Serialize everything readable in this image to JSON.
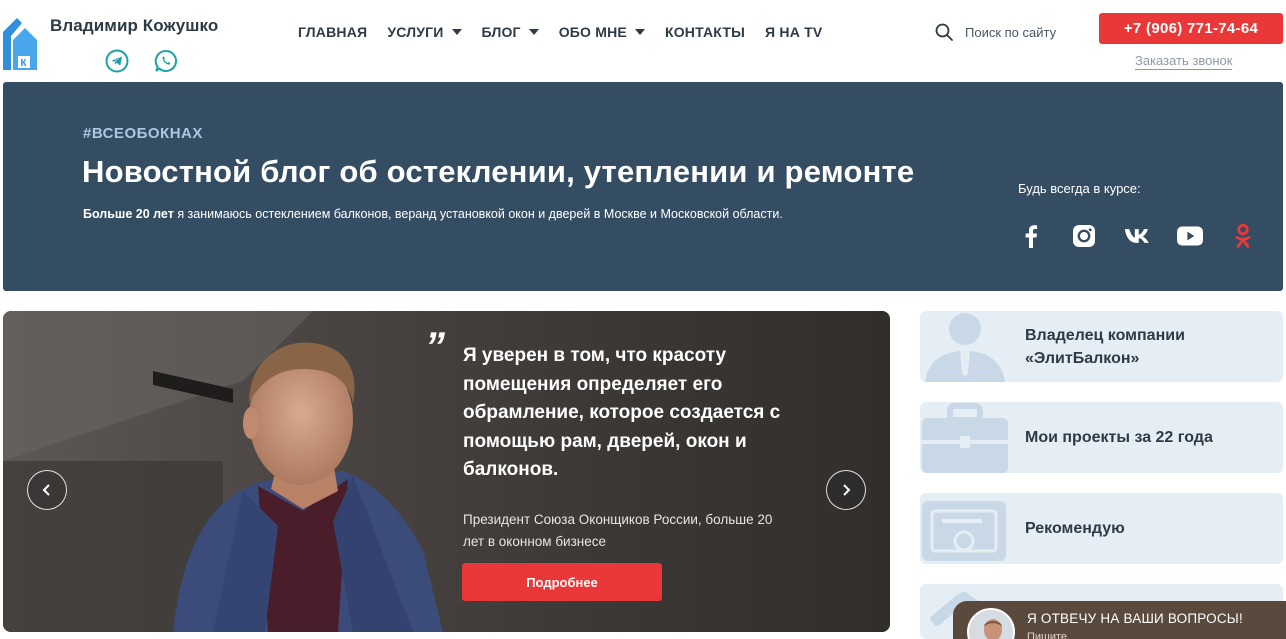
{
  "header": {
    "brand_name": "Владимир Кожушко",
    "nav": [
      {
        "label": "ГЛАВНАЯ",
        "dropdown": false
      },
      {
        "label": "УСЛУГИ",
        "dropdown": true
      },
      {
        "label": "БЛОГ",
        "dropdown": true
      },
      {
        "label": "ОБО МНЕ",
        "dropdown": true
      },
      {
        "label": "КОНТАКТЫ",
        "dropdown": false
      },
      {
        "label": "Я НА TV",
        "dropdown": false
      }
    ],
    "search_placeholder": "Поиск по сайту",
    "phone": "+7 (906) 771-74-64",
    "callback_label": "Заказать звонок",
    "messengers": [
      "telegram-icon",
      "whatsapp-icon"
    ]
  },
  "banner": {
    "hashtag": "#ВСЕОБОКНАХ",
    "title": "Новостной блог об остеклении, утеплении и ремонте",
    "desc_bold": "Больше 20 лет",
    "desc_rest": " я занимаюсь остеклением балконов, веранд установкой окон и дверей в Москве и Московской области.",
    "follow_label": "Будь всегда в курсе:",
    "socials": [
      "facebook-icon",
      "instagram-icon",
      "vk-icon",
      "youtube-icon",
      "odnoklassniki-icon"
    ]
  },
  "slider": {
    "quote_mark": "”",
    "quote": "Я уверен в том, что красоту помещения определяет его обрамление, которое создается с помощью рам, дверей, окон и балконов.",
    "author": "Президент Союза Оконщиков России, больше 20 лет в оконном бизнесе",
    "button_label": "Подробнее"
  },
  "cards": [
    {
      "label": "Владелец компании «ЭлитБалкон»",
      "icon": "businessman-icon"
    },
    {
      "label": "Мои проекты за 22 года",
      "icon": "briefcase-icon"
    },
    {
      "label": "Рекомендую",
      "icon": "certificate-icon"
    },
    {
      "label": "",
      "icon": "tools-icon"
    }
  ],
  "chat": {
    "title": "Я ОТВЕЧУ НА ВАШИ ВОПРОСЫ!",
    "subtitle": "Пишите"
  },
  "colors": {
    "accent_red": "#ea3838",
    "banner_bg": "#354d63",
    "card_bg": "#e6eef5",
    "hashtag": "#aac7e3",
    "messenger_teal": "#1aa3a3"
  }
}
